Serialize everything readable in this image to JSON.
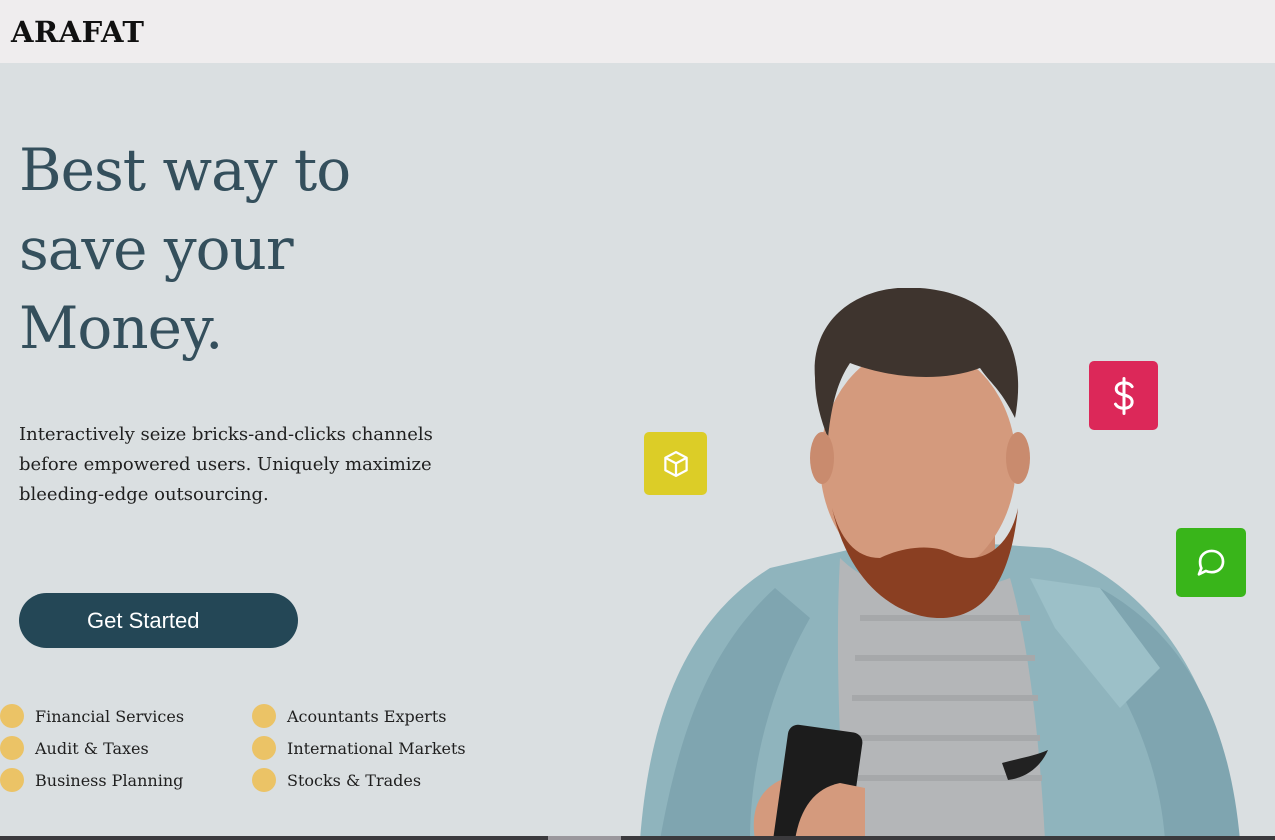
{
  "navbar": {
    "brand": "ARAFAT"
  },
  "hero": {
    "headline_lines": [
      "Best way to",
      "save your",
      "Money."
    ],
    "description_lines": [
      "Interactively seize bricks-and-clicks channels",
      "before empowered users. Uniquely maximize",
      "bleeding-edge outsourcing."
    ],
    "cta_label": "Get Started"
  },
  "features": {
    "bullet_color": "#ebc366",
    "column_1": [
      "Financial Services",
      "Audit & Taxes",
      "Business Planning"
    ],
    "column_2": [
      "Acountants Experts",
      "International Markets",
      "Stocks & Trades"
    ]
  },
  "floating_icons": [
    {
      "name": "cube-icon",
      "color": "#dccd27"
    },
    {
      "name": "dollar-icon",
      "color": "#dc2859"
    },
    {
      "name": "chat-bubble-icon",
      "color": "#39b51a"
    }
  ],
  "colors": {
    "navbar_bg": "#efedee",
    "hero_bg": "#dadfe1",
    "headline": "#344f5c",
    "cta_bg": "#244756"
  }
}
